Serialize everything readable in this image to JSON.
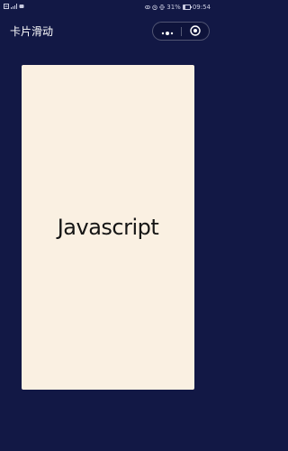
{
  "status_bar": {
    "battery_text": "31%",
    "time": "09:54",
    "battery_level": 0.31,
    "icons": [
      "notification-icon",
      "signal-icon",
      "app-icon",
      "eye-icon",
      "alarm-icon",
      "vibrate-icon",
      "battery-icon"
    ]
  },
  "nav": {
    "title": "卡片滑动",
    "menu_icon": "more-dots-icon",
    "close_icon": "target-close-icon"
  },
  "card": {
    "text": "Javascript"
  },
  "colors": {
    "background": "#121845",
    "card": "#faf0e2",
    "text_on_card": "#151515",
    "nav_text": "#ffffff"
  }
}
